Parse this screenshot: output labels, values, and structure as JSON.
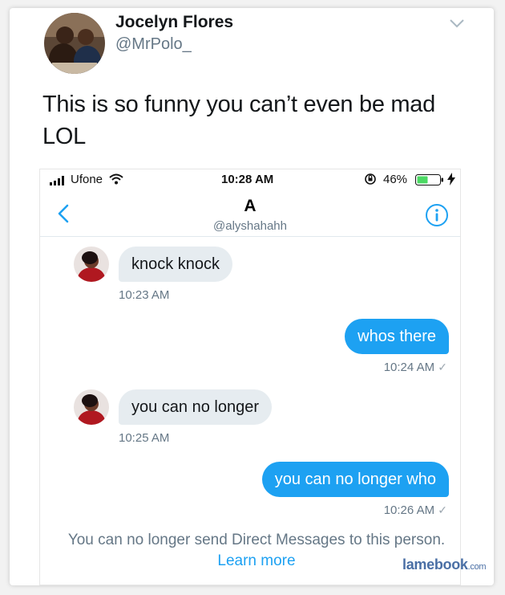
{
  "tweet": {
    "author_name": "Jocelyn Flores",
    "author_handle": "@MrPolo_",
    "text": "This is so funny you can’t even be mad LOL"
  },
  "phone": {
    "status_bar": {
      "carrier": "Ufone",
      "time": "10:28 AM",
      "battery": "46%"
    },
    "conversation": {
      "name": "A",
      "handle": "@alyshahahh"
    },
    "messages": [
      {
        "direction": "in",
        "text": "knock knock",
        "time": "10:23 AM"
      },
      {
        "direction": "out",
        "text": "whos there",
        "time": "10:24 AM"
      },
      {
        "direction": "in",
        "text": "you can no longer",
        "time": "10:25 AM"
      },
      {
        "direction": "out",
        "text": "you can no longer who",
        "time": "10:26 AM"
      }
    ],
    "notice": {
      "text": "You can no longer send Direct Messages to this person.",
      "link": "Learn more"
    }
  },
  "watermark": {
    "brand": "lamebook",
    "tld": ".com"
  },
  "colors": {
    "accent": "#1da1f2",
    "incoming_bubble": "#e6ecf0",
    "secondary_text": "#657786"
  }
}
